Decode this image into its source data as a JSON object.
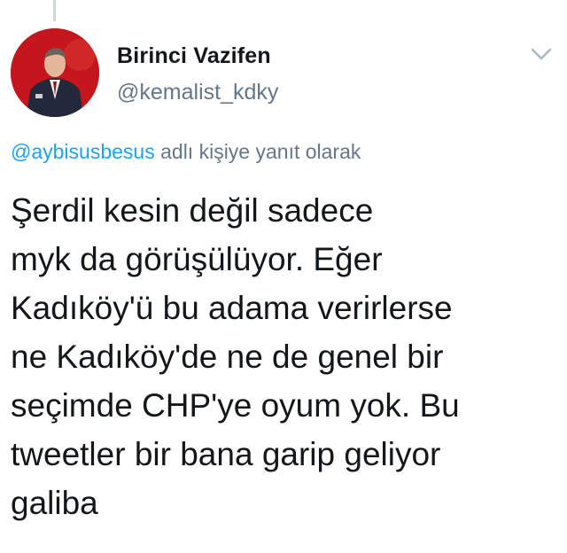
{
  "tweet": {
    "author": {
      "display_name": "Birinci Vazifen",
      "handle": "@kemalist_kdky",
      "avatar_icon": "profile-photo"
    },
    "reply_to": {
      "mention": "@aybisusbesus",
      "suffix": "adlı kişiye yanıt olarak"
    },
    "text_lines": [
      "Şerdil kesin değil sadece",
      "myk da görüşülüyor. Eğer",
      "Kadıköy'ü bu adama verirlerse",
      "ne Kadıköy'de ne de genel bir",
      "seçimde CHP'ye oyum yok. Bu",
      "tweetler bir bana garip geliyor",
      "galiba"
    ],
    "menu_icon": "chevron-down-icon"
  },
  "colors": {
    "text_primary": "#14171a",
    "text_secondary": "#657786",
    "link": "#1da1f2",
    "avatar_background": "#c4161c"
  }
}
